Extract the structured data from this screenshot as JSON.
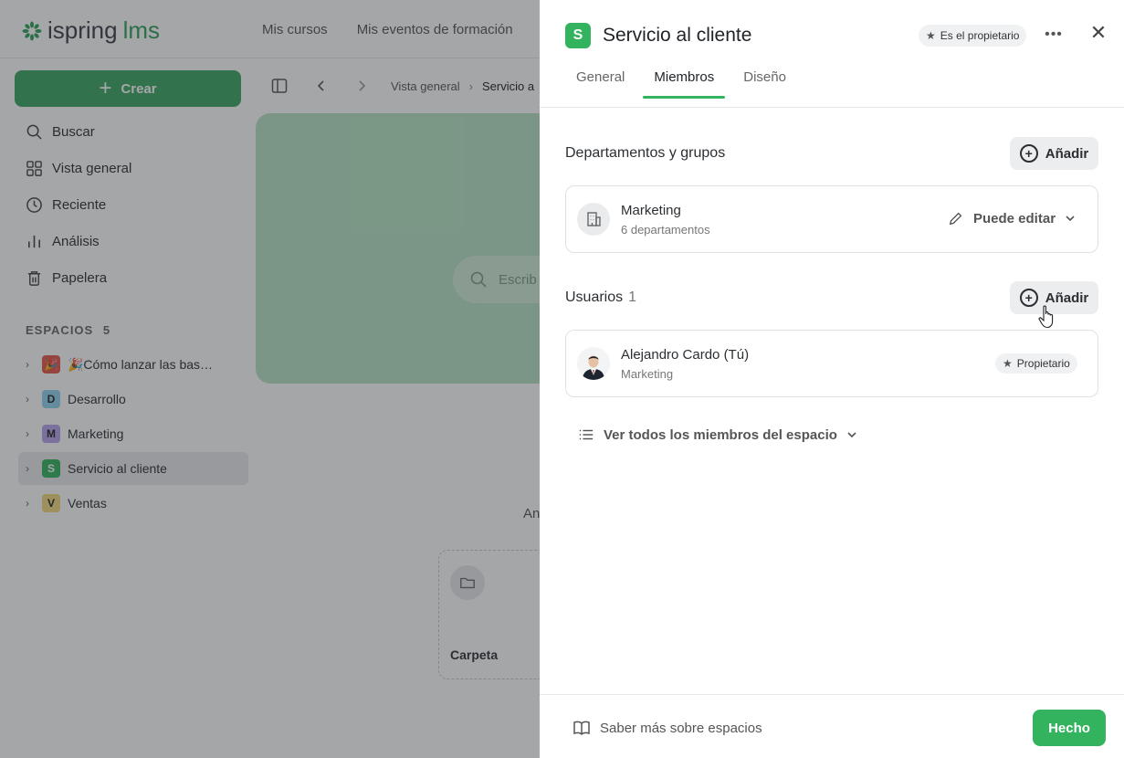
{
  "app": {
    "logo_main": "ispring",
    "logo_accent": "lms",
    "topnav": [
      "Mis cursos",
      "Mis eventos de formación"
    ]
  },
  "sidebar": {
    "create_label": "Crear",
    "items": [
      {
        "label": "Buscar",
        "icon": "search-icon"
      },
      {
        "label": "Vista general",
        "icon": "grid-icon"
      },
      {
        "label": "Reciente",
        "icon": "clock-icon"
      },
      {
        "label": "Análisis",
        "icon": "chart-icon"
      },
      {
        "label": "Papelera",
        "icon": "trash-icon"
      }
    ],
    "spaces_title": "ESPACIOS",
    "spaces_count": "5",
    "spaces": [
      {
        "badge": "🎉",
        "label": "🎉Cómo lanzar las bas…",
        "color": "#e4574b"
      },
      {
        "badge": "D",
        "label": "Desarrollo",
        "color": "#8fd3ef"
      },
      {
        "badge": "M",
        "label": "Marketing",
        "color": "#b9a2f0"
      },
      {
        "badge": "S",
        "label": "Servicio al cliente",
        "color": "#34b35f"
      },
      {
        "badge": "V",
        "label": "Ventas",
        "color": "#f2d97c"
      }
    ]
  },
  "content": {
    "breadcrumb": [
      "Vista general",
      "Servicio a"
    ],
    "search_placeholder": "Escrib",
    "partial_text": "An",
    "folder_label": "Carpeta"
  },
  "panel": {
    "badge": "S",
    "title": "Servicio al cliente",
    "owner_chip": "Es el propietario",
    "tabs": [
      "General",
      "Miembros",
      "Diseño"
    ],
    "active_tab": "Miembros",
    "departments": {
      "title": "Departamentos y grupos",
      "add_label": "Añadir",
      "item": {
        "name": "Marketing",
        "sub": "6 departamentos",
        "permission": "Puede editar"
      }
    },
    "users": {
      "title": "Usuarios",
      "count": "1",
      "add_label": "Añadir",
      "item": {
        "name": "Alejandro Cardo (Tú)",
        "sub": "Marketing",
        "role": "Propietario"
      }
    },
    "view_all": "Ver todos los miembros del espacio",
    "learn_more": "Saber más sobre espacios",
    "done_label": "Hecho"
  },
  "colors": {
    "brand": "#34b35f",
    "overlay": "rgba(40,44,48,0.42)"
  }
}
